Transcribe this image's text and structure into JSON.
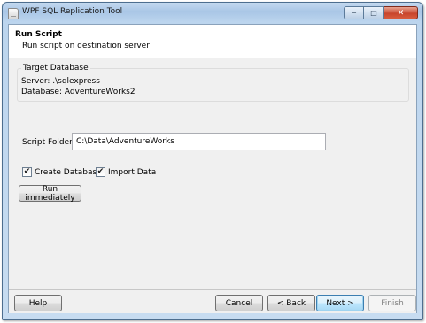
{
  "window": {
    "title": "WPF SQL Replication Tool",
    "controls": {
      "minimize": "─",
      "maximize": "□",
      "close": "✕"
    }
  },
  "header": {
    "title": "Run Script",
    "subtitle": "Run script on destination server"
  },
  "target_database": {
    "legend": "Target Database",
    "server_line": "Server: .\\sqlexpress",
    "database_line": "Database: AdventureWorks2"
  },
  "script_folder": {
    "label": "Script Folder:",
    "value": "C:\\Data\\AdventureWorks"
  },
  "options": {
    "create_database": {
      "label": "Create Database",
      "checked": true
    },
    "import_data": {
      "label": "Import Data",
      "checked": true
    }
  },
  "run_immediately_label": "Run immediately",
  "footer": {
    "help": "Help",
    "cancel": "Cancel",
    "back": "< Back",
    "next": "Next >",
    "finish": "Finish"
  },
  "icons": {
    "app": "document-icon",
    "check": "✔"
  },
  "colors": {
    "title_gradient": "#a9c6e6",
    "close_button": "#c8452c",
    "body_background": "#f0f0f0",
    "default_button_border": "#3c7fb1"
  }
}
